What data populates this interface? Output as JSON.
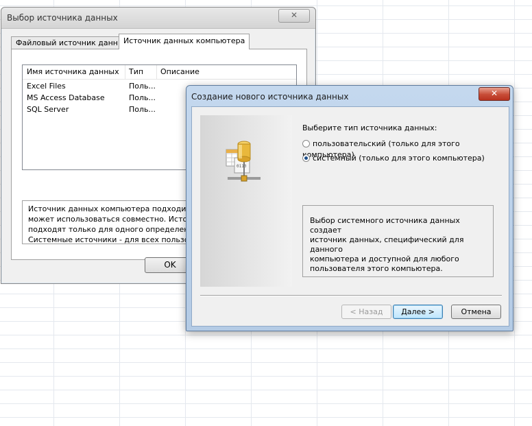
{
  "window_back": {
    "title": "Выбор источника данных",
    "close_glyph": "✕",
    "tabs": [
      {
        "label": "Файловый источник данных"
      },
      {
        "label": "Источник данных компьютера"
      }
    ],
    "columns": [
      "Имя источника данных",
      "Тип",
      "Описание"
    ],
    "rows": [
      {
        "name": "Excel Files",
        "type": "Поль...",
        "desc": ""
      },
      {
        "name": "MS Access Database",
        "type": "Поль...",
        "desc": ""
      },
      {
        "name": "SQL Server",
        "type": "Поль...",
        "desc": ""
      }
    ],
    "description_lines": [
      "Источник данных компьютера подходит толь",
      "может использоваться совместно.  Источник",
      "подходят только для одного определенного п",
      "Системные источники - для всех пользовател"
    ],
    "ok_label": "OK"
  },
  "window_front": {
    "title": "Создание нового источника данных",
    "close_glyph": "✕",
    "icon": "database-server-icon",
    "prompt": "Выберите тип источника данных:",
    "options": [
      {
        "label": "пользовательский (только для этого компьютера)",
        "selected": false
      },
      {
        "label": "системный (только для этого компьютера)",
        "selected": true
      }
    ],
    "info_lines": [
      "Выбор системного источника данных создает",
      "источник данных, специфический для данного",
      "компьютера и доступной для любого",
      "пользователя этого компьютера."
    ],
    "buttons": {
      "back": "< Назад",
      "next": "Далее >",
      "cancel": "Отмена"
    }
  },
  "colors": {
    "accent_blue": "#3c7fb1",
    "close_red": "#c74c37"
  }
}
